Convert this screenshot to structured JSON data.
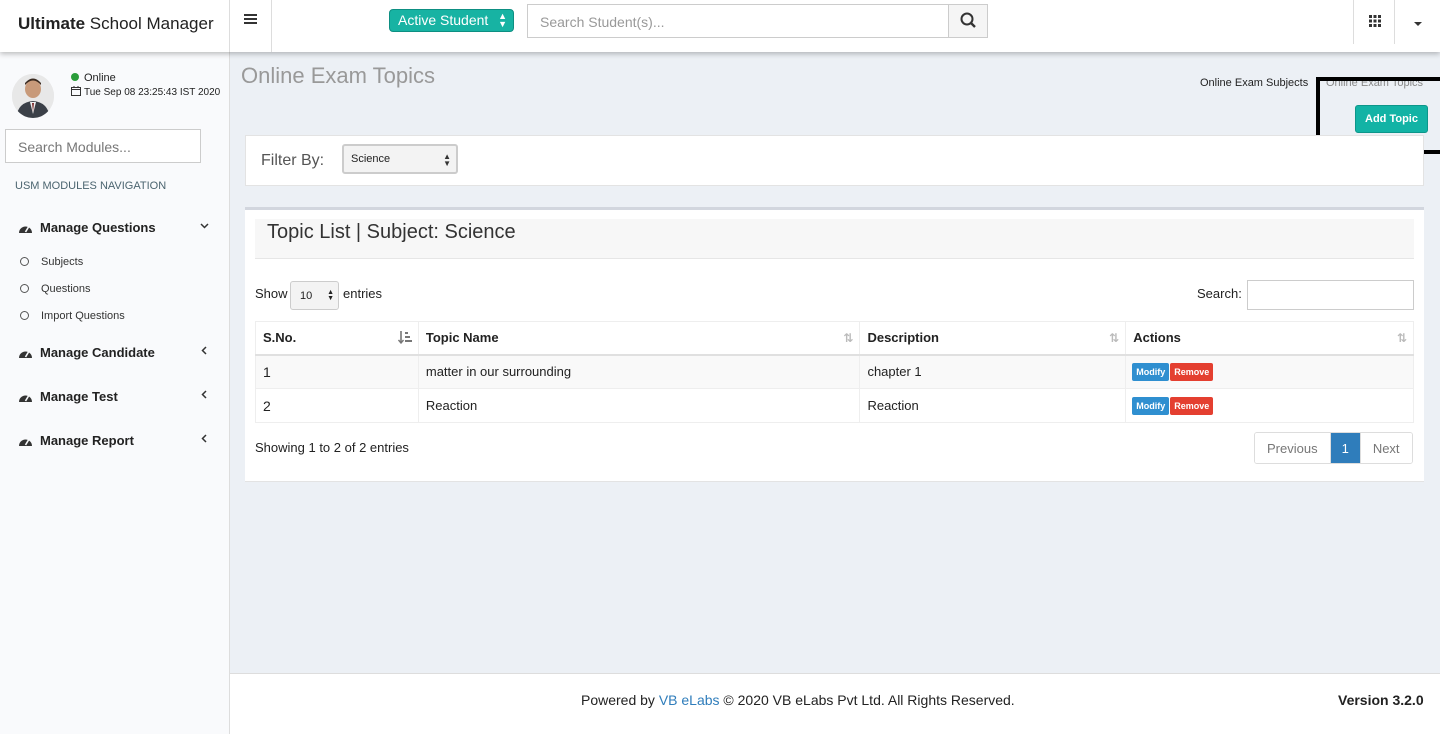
{
  "header": {
    "logo_bold": "Ultimate",
    "logo_rest": " School Manager",
    "student_filter": "Active Student",
    "search_placeholder": "Search Student(s)..."
  },
  "sidebar": {
    "status": "Online",
    "datetime": "Tue Sep 08 23:25:43 IST 2020",
    "module_search_placeholder": "Search Modules...",
    "nav_header": "USM MODULES NAVIGATION",
    "items": [
      {
        "label": "Manage Questions",
        "expanded": true
      },
      {
        "label": "Manage Candidate",
        "expanded": false
      },
      {
        "label": "Manage Test",
        "expanded": false
      },
      {
        "label": "Manage Report",
        "expanded": false
      }
    ],
    "subitems": [
      "Subjects",
      "Questions",
      "Import Questions"
    ]
  },
  "page": {
    "title": "Online Exam Topics",
    "breadcrumb": [
      "Online Exam Subjects",
      "Online Exam Topics"
    ],
    "add_button": "Add Topic"
  },
  "filter": {
    "label": "Filter By:",
    "selected": "Science"
  },
  "table_box": {
    "title": "Topic List | Subject: Science",
    "show_label": "Show",
    "page_size": "10",
    "entries_label": "entries",
    "search_label": "Search:",
    "columns": [
      "S.No.",
      "Topic Name",
      "Description",
      "Actions"
    ],
    "rows": [
      {
        "sno": "1",
        "topic": "matter in our surrounding",
        "description": "chapter 1"
      },
      {
        "sno": "2",
        "topic": "Reaction",
        "description": "Reaction"
      }
    ],
    "modify_label": "Modify",
    "remove_label": "Remove",
    "showing": "Showing 1 to 2 of 2 entries",
    "pager": {
      "prev": "Previous",
      "current": "1",
      "next": "Next"
    }
  },
  "footer": {
    "powered_by": "Powered by ",
    "company_link": "VB eLabs",
    "copyright": " © 2020 VB eLabs Pvt Ltd. All Rights Reserved.",
    "version": "Version 3.2.0"
  },
  "colors": {
    "accent": "#12b3a5",
    "primary_blue": "#2f7dbb",
    "danger": "#e43f30",
    "online": "#2a9d3a"
  }
}
